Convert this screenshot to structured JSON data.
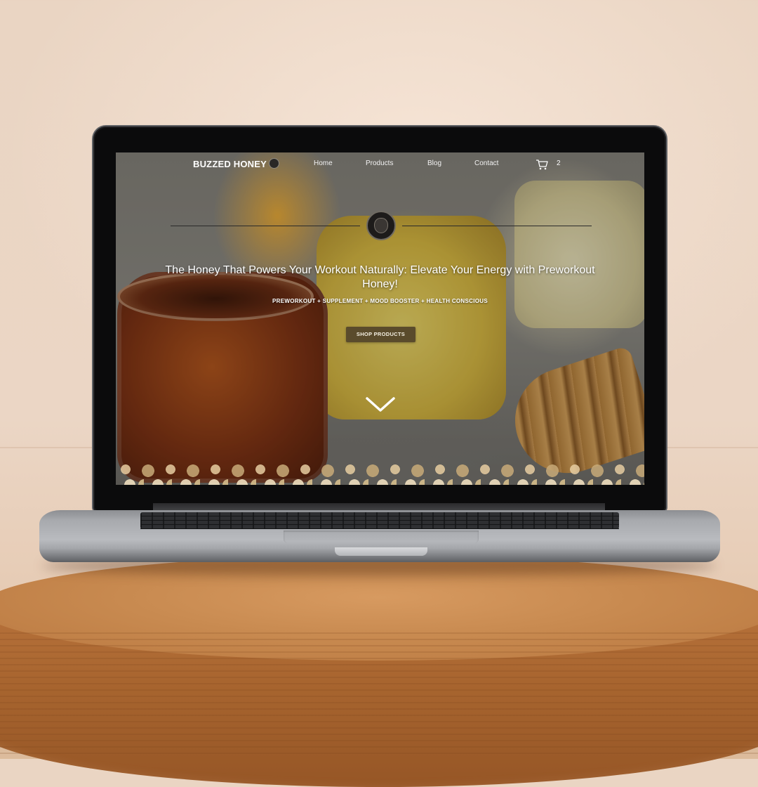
{
  "site": {
    "brand": "BUZZED HONEY",
    "nav": {
      "items": [
        {
          "label": "Home"
        },
        {
          "label": "Products"
        },
        {
          "label": "Blog"
        },
        {
          "label": "Contact"
        }
      ],
      "cart_count": "2"
    },
    "hero": {
      "headline": "The Honey That Powers Your Workout Naturally: Elevate Your Energy with Preworkout Honey!",
      "tagline": "PREWORKOUT + SUPPLEMENT + MOOD BOOSTER + HEALTH CONSCIOUS",
      "cta_label": "SHOP PRODUCTS"
    }
  },
  "icons": {
    "cart": "cart-icon",
    "logo_badge": "bear-logo-icon",
    "scroll": "chevron-down-icon"
  },
  "colors": {
    "cta_background": "#5a4b2c",
    "text": "#ffffff"
  }
}
